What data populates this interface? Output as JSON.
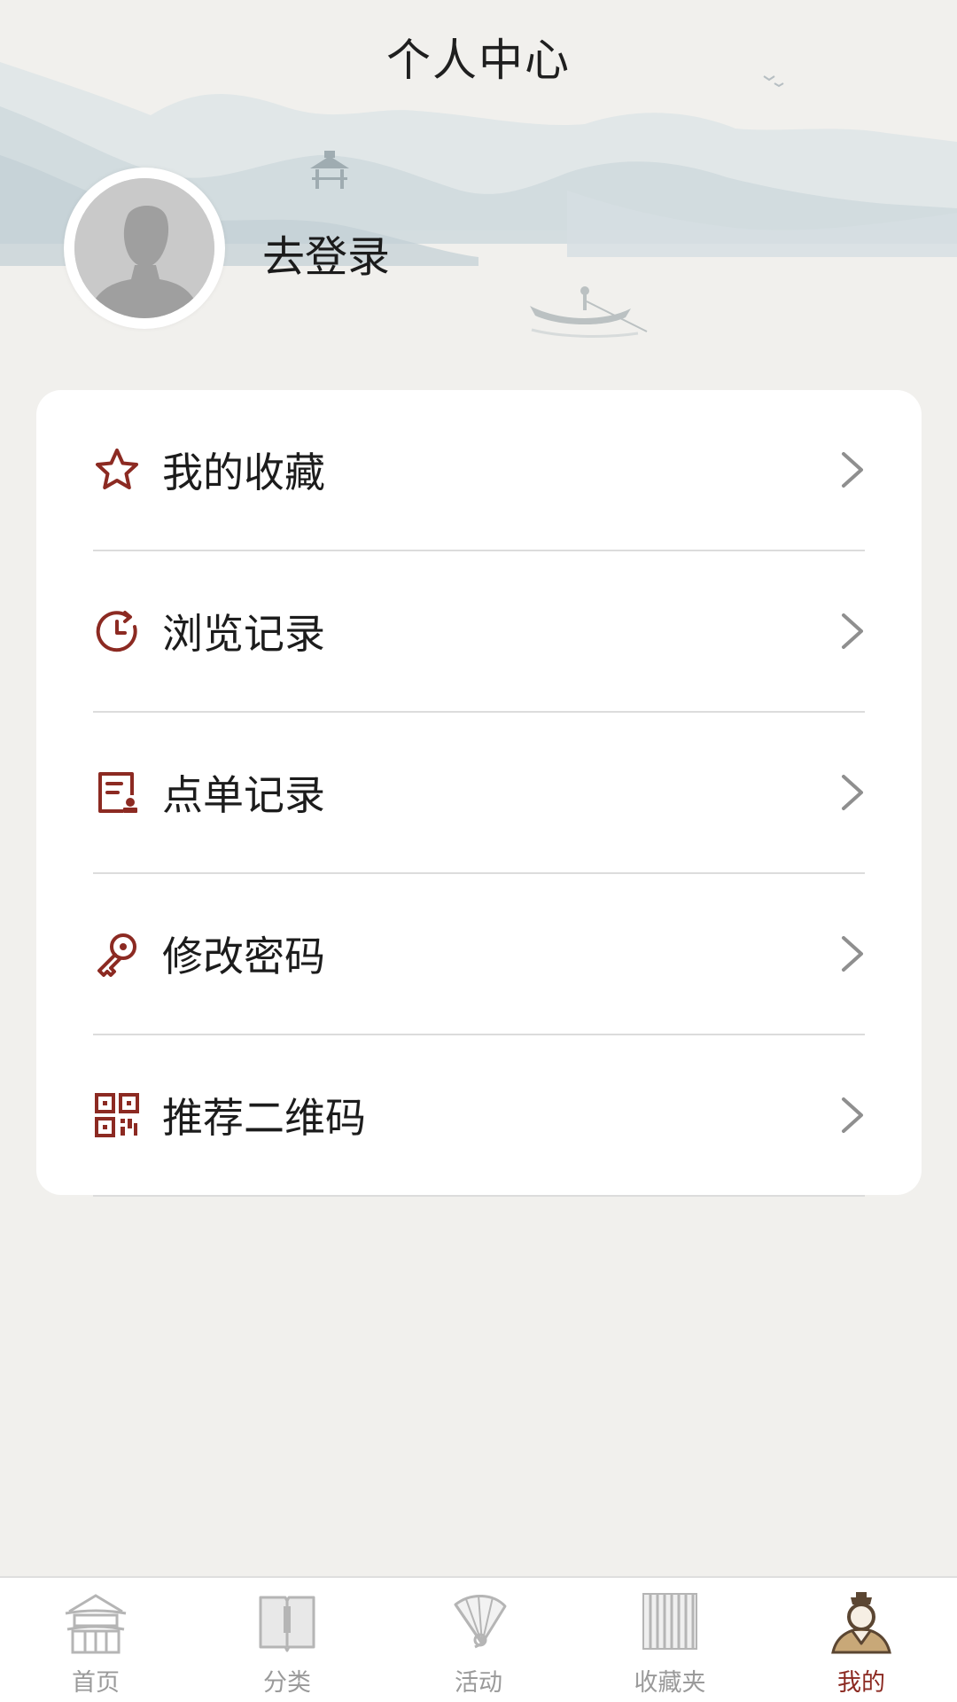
{
  "header": {
    "title": "个人中心",
    "login_text": "去登录"
  },
  "menu": {
    "items": [
      {
        "label": "我的收藏",
        "icon": "star-icon"
      },
      {
        "label": "浏览记录",
        "icon": "history-clock-icon"
      },
      {
        "label": "点单记录",
        "icon": "order-record-icon"
      },
      {
        "label": "修改密码",
        "icon": "key-icon"
      },
      {
        "label": "推荐二维码",
        "icon": "qr-code-icon"
      }
    ]
  },
  "tabbar": {
    "tabs": [
      {
        "label": "首页",
        "icon": "pavilion-icon",
        "active": false
      },
      {
        "label": "分类",
        "icon": "book-icon",
        "active": false
      },
      {
        "label": "活动",
        "icon": "fan-icon",
        "active": false
      },
      {
        "label": "收藏夹",
        "icon": "bamboo-scroll-icon",
        "active": false
      },
      {
        "label": "我的",
        "icon": "scholar-avatar-icon",
        "active": true
      }
    ]
  },
  "colors": {
    "accent": "#8c2a22",
    "background": "#f1f0ed",
    "card": "#ffffff",
    "tab_inactive": "#9a9a9a"
  }
}
